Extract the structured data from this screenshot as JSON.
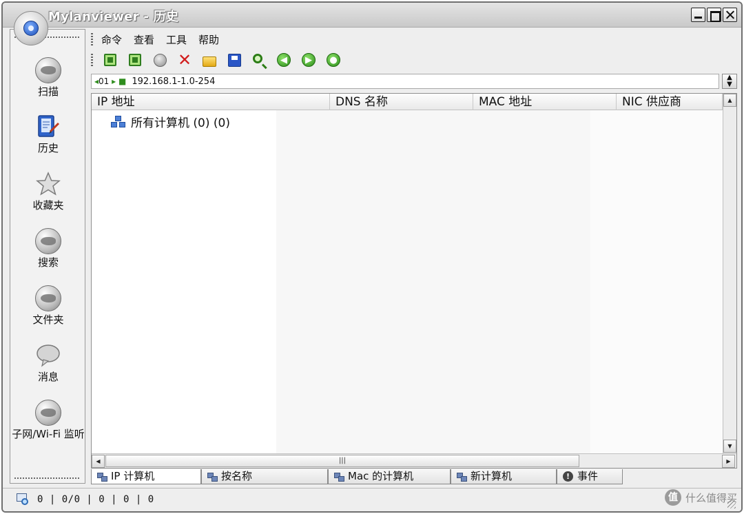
{
  "window": {
    "title": "Mylanviewer - 历史"
  },
  "menu": [
    {
      "label": "命令"
    },
    {
      "label": "查看"
    },
    {
      "label": "工具"
    },
    {
      "label": "帮助"
    }
  ],
  "toolbar": [
    {
      "icon": "scan-start-icon"
    },
    {
      "icon": "scan-range-icon"
    },
    {
      "icon": "stop-icon"
    },
    {
      "icon": "delete-icon"
    },
    {
      "icon": "open-folder-icon"
    },
    {
      "icon": "save-icon"
    },
    {
      "icon": "find-icon"
    },
    {
      "icon": "back-arrow-icon"
    },
    {
      "icon": "forward-arrow-icon"
    },
    {
      "icon": "refresh-icon"
    }
  ],
  "address": {
    "prefix": "01",
    "value": "192.168.1-1.0-254"
  },
  "sidebar": [
    {
      "label": "扫描",
      "icon": "scan-globe-icon"
    },
    {
      "label": "历史",
      "icon": "history-icon"
    },
    {
      "label": "收藏夹",
      "icon": "star-icon"
    },
    {
      "label": "搜索",
      "icon": "search-globe-icon"
    },
    {
      "label": "文件夹",
      "icon": "folder-globe-icon"
    },
    {
      "label": "消息",
      "icon": "message-bubble-icon"
    },
    {
      "label": "子网/Wi-Fi 监听",
      "icon": "subnet-globe-icon"
    }
  ],
  "columns": [
    {
      "label": "IP 地址"
    },
    {
      "label": "DNS 名称"
    },
    {
      "label": "MAC 地址"
    },
    {
      "label": "NIC 供应商"
    }
  ],
  "tree": {
    "label": "所有计算机 (0) (0)"
  },
  "tabs": [
    {
      "label": "IP 计算机"
    },
    {
      "label": "按名称"
    },
    {
      "label": "Mac 的计算机"
    },
    {
      "label": "新计算机"
    },
    {
      "label": "事件"
    }
  ],
  "status": {
    "text": "0 | 0/0 | 0 | 0 | 0"
  },
  "watermark": {
    "text": "什么值得买"
  },
  "colors": {
    "accent_green": "#2f8d1e",
    "delete_red": "#d11d1d",
    "save_blue": "#2a56c6"
  }
}
